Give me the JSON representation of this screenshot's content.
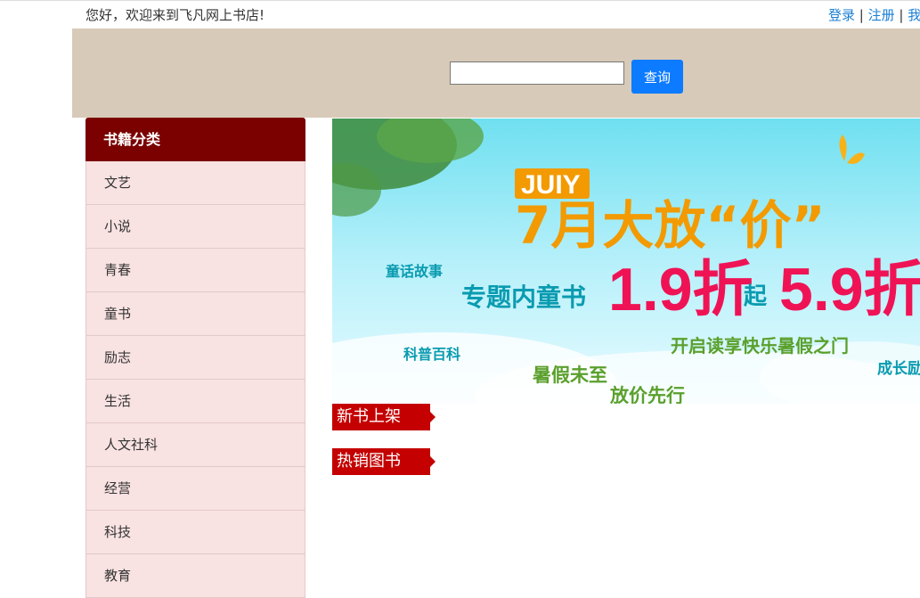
{
  "topbar": {
    "welcome": "您好，欢迎来到飞凡网上书店!",
    "login": "登录",
    "sep1": " | ",
    "register": "注册",
    "sep2": " | ",
    "my": "我"
  },
  "search": {
    "value": "",
    "button_label": "查询"
  },
  "sidebar": {
    "title": "书籍分类",
    "items": [
      {
        "label": "文艺"
      },
      {
        "label": "小说"
      },
      {
        "label": "青春"
      },
      {
        "label": "童书"
      },
      {
        "label": "励志"
      },
      {
        "label": "生活"
      },
      {
        "label": "人文社科"
      },
      {
        "label": "经营"
      },
      {
        "label": "科技"
      },
      {
        "label": "教育"
      }
    ]
  },
  "banner": {
    "badge": "JUIY",
    "headline": "7月大放“价”",
    "subtitle": "专题内童书",
    "price1": "1.9折",
    "qi": "起",
    "price2": "5.9折",
    "tag1": "童话故事",
    "tag2": "科普百科",
    "tag3": "开启读享快乐暑假之门",
    "tag4": "暑假未至",
    "tag5": "放价先行",
    "tag6": "成长励"
  },
  "sections": {
    "new_books": "新书上架",
    "hot_books": "热销图书"
  }
}
